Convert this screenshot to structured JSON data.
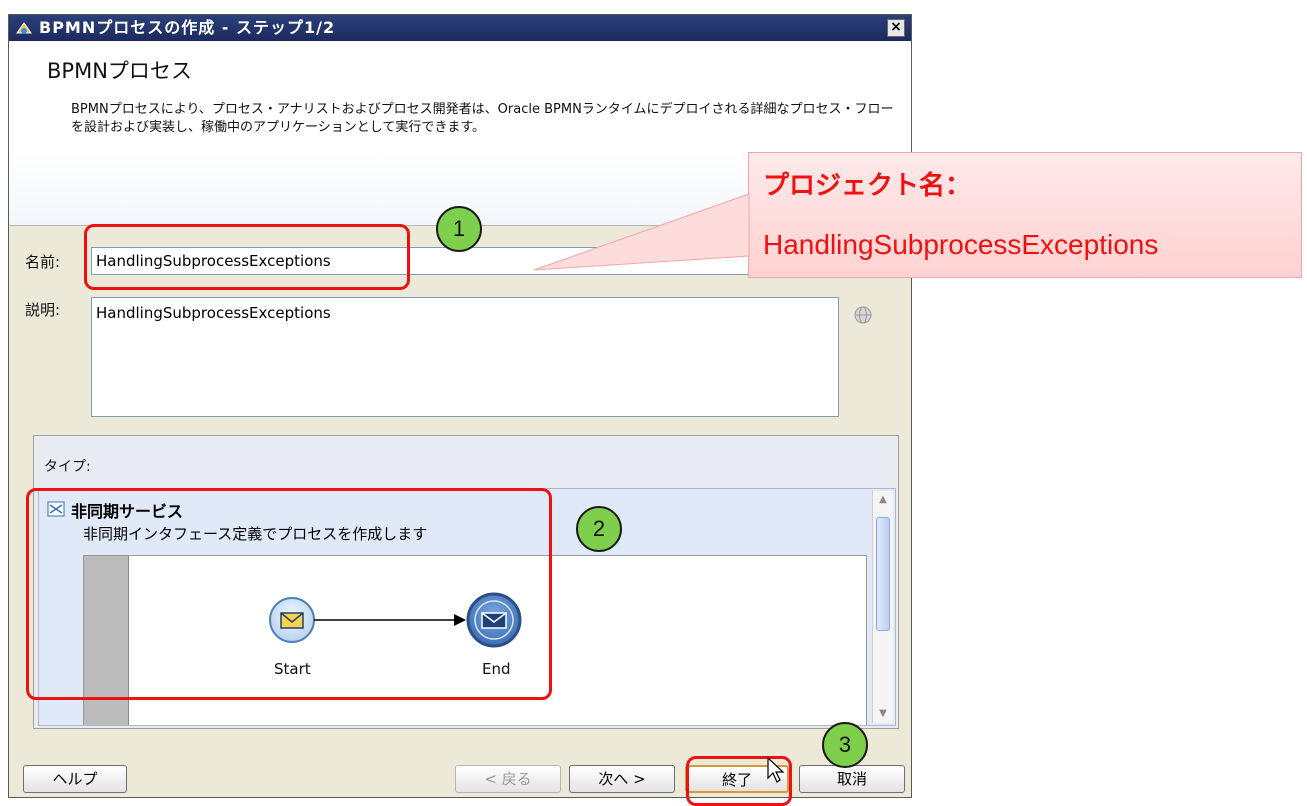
{
  "window": {
    "title": "BPMNプロセスの作成 - ステップ1/2",
    "close_label": "×"
  },
  "header": {
    "title": "BPMNプロセス",
    "description": "BPMNプロセスにより、プロセス・アナリストおよびプロセス開発者は、Oracle BPMNランタイムにデプロイされる詳細なプロセス・フローを設計および実装し、稼働中のアプリケーションとして実行できます。"
  },
  "form": {
    "name_label": "名前:",
    "name_value": "HandlingSubprocessExceptions",
    "description_label": "説明:",
    "description_value": "HandlingSubprocessExceptions"
  },
  "type_section": {
    "label": "タイプ:",
    "selected_item": {
      "title": "非同期サービス",
      "description": "非同期インタフェース定義でプロセスを作成します",
      "diagram": {
        "start_label": "Start",
        "end_label": "End"
      }
    }
  },
  "buttons": {
    "help": "ヘルプ",
    "back": "< 戻る",
    "next": "次へ >",
    "finish": "終了",
    "cancel": "取消"
  },
  "annotations": {
    "step1": "1",
    "step2": "2",
    "step3": "3",
    "callout_title": "プロジェクト名：",
    "callout_value": "HandlingSubprocessExceptions",
    "highlight_color": "#ee1111",
    "circle_color": "#7ed04c"
  }
}
